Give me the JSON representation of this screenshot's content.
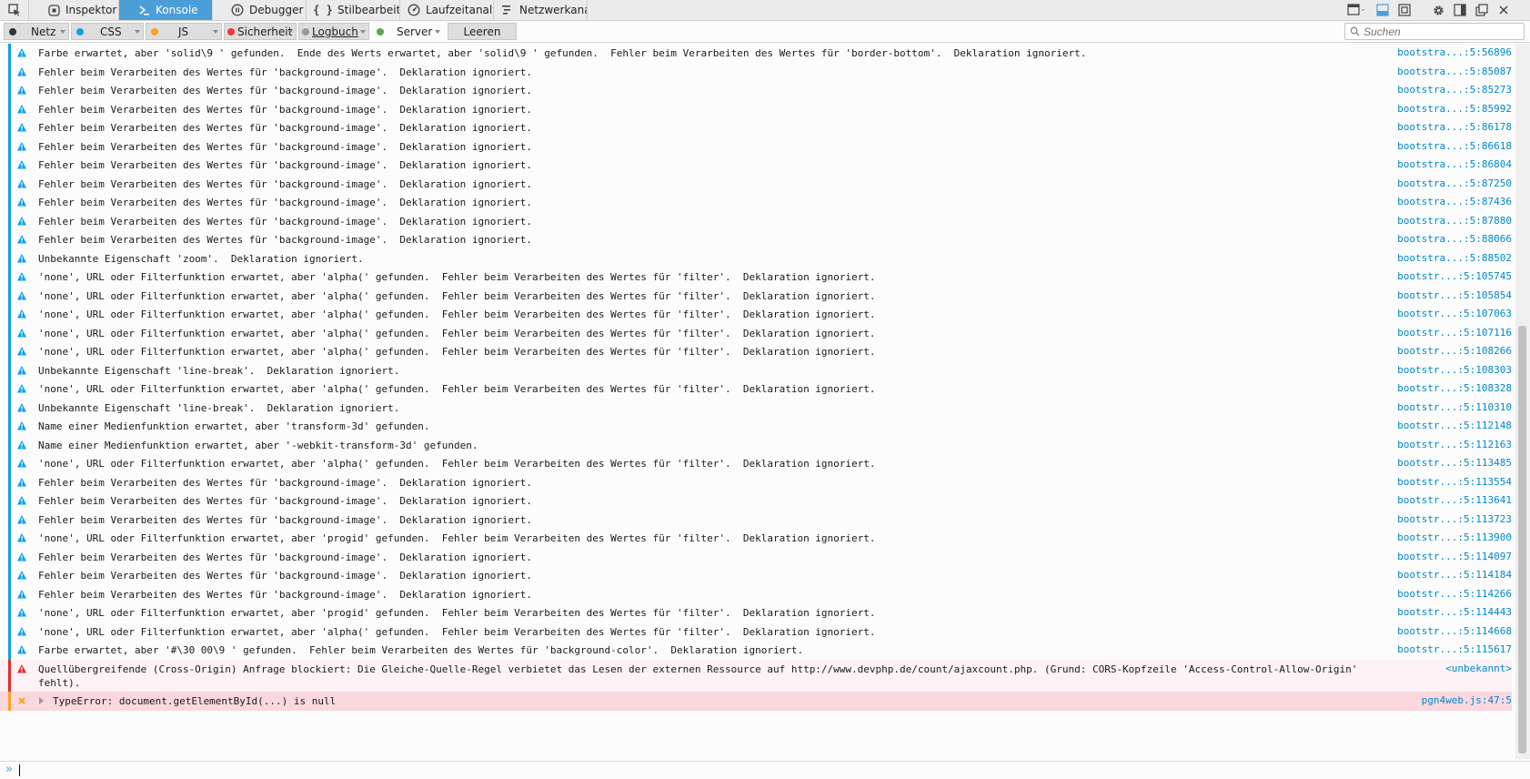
{
  "toolbar": {
    "tabs": [
      {
        "label": "Inspektor",
        "icon": "inspector-icon"
      },
      {
        "label": "Konsole",
        "icon": "console-icon",
        "active": true
      },
      {
        "label": "Debugger",
        "icon": "debugger-icon"
      },
      {
        "label": "Stilbearbeitu...",
        "icon": "style-editor-icon"
      },
      {
        "label": "Laufzeitanaly...",
        "icon": "performance-icon"
      },
      {
        "label": "Netzwerkana...",
        "icon": "network-icon"
      }
    ],
    "accent": "#4c9ed9"
  },
  "filters": {
    "netz": "Netz",
    "css": "CSS",
    "js": "JS",
    "sicherheit": "Sicherheit",
    "logbuch": "Logbuch",
    "server": "Server",
    "leeren": "Leeren",
    "search_placeholder": "Suchen",
    "colors": {
      "netz": "#333333",
      "css": "#0ca2e8",
      "js": "#f7a51b",
      "sicherheit": "#ee3a3a",
      "logbuch": "#999999",
      "server": "#5ba846"
    }
  },
  "console": {
    "messages": [
      {
        "sev": "warn",
        "text": "Farbe erwartet, aber 'solid\\9 ' gefunden.  Ende des Werts erwartet, aber 'solid\\9 ' gefunden.  Fehler beim Verarbeiten des Wertes für 'border-bottom'.  Deklaration ignoriert.",
        "loc": "bootstra...:5:56896"
      },
      {
        "sev": "warn",
        "text": "Fehler beim Verarbeiten des Wertes für 'background-image'.  Deklaration ignoriert.",
        "loc": "bootstra...:5:85087"
      },
      {
        "sev": "warn",
        "text": "Fehler beim Verarbeiten des Wertes für 'background-image'.  Deklaration ignoriert.",
        "loc": "bootstra...:5:85273"
      },
      {
        "sev": "warn",
        "text": "Fehler beim Verarbeiten des Wertes für 'background-image'.  Deklaration ignoriert.",
        "loc": "bootstra...:5:85992"
      },
      {
        "sev": "warn",
        "text": "Fehler beim Verarbeiten des Wertes für 'background-image'.  Deklaration ignoriert.",
        "loc": "bootstra...:5:86178"
      },
      {
        "sev": "warn",
        "text": "Fehler beim Verarbeiten des Wertes für 'background-image'.  Deklaration ignoriert.",
        "loc": "bootstra...:5:86618"
      },
      {
        "sev": "warn",
        "text": "Fehler beim Verarbeiten des Wertes für 'background-image'.  Deklaration ignoriert.",
        "loc": "bootstra...:5:86804"
      },
      {
        "sev": "warn",
        "text": "Fehler beim Verarbeiten des Wertes für 'background-image'.  Deklaration ignoriert.",
        "loc": "bootstra...:5:87250"
      },
      {
        "sev": "warn",
        "text": "Fehler beim Verarbeiten des Wertes für 'background-image'.  Deklaration ignoriert.",
        "loc": "bootstra...:5:87436"
      },
      {
        "sev": "warn",
        "text": "Fehler beim Verarbeiten des Wertes für 'background-image'.  Deklaration ignoriert.",
        "loc": "bootstra...:5:87880"
      },
      {
        "sev": "warn",
        "text": "Fehler beim Verarbeiten des Wertes für 'background-image'.  Deklaration ignoriert.",
        "loc": "bootstra...:5:88066"
      },
      {
        "sev": "warn",
        "text": "Unbekannte Eigenschaft 'zoom'.  Deklaration ignoriert.",
        "loc": "bootstra...:5:88502"
      },
      {
        "sev": "warn",
        "text": "'none', URL oder Filterfunktion erwartet, aber 'alpha(' gefunden.  Fehler beim Verarbeiten des Wertes für 'filter'.  Deklaration ignoriert.",
        "loc": "bootstr...:5:105745"
      },
      {
        "sev": "warn",
        "text": "'none', URL oder Filterfunktion erwartet, aber 'alpha(' gefunden.  Fehler beim Verarbeiten des Wertes für 'filter'.  Deklaration ignoriert.",
        "loc": "bootstr...:5:105854"
      },
      {
        "sev": "warn",
        "text": "'none', URL oder Filterfunktion erwartet, aber 'alpha(' gefunden.  Fehler beim Verarbeiten des Wertes für 'filter'.  Deklaration ignoriert.",
        "loc": "bootstr...:5:107063"
      },
      {
        "sev": "warn",
        "text": "'none', URL oder Filterfunktion erwartet, aber 'alpha(' gefunden.  Fehler beim Verarbeiten des Wertes für 'filter'.  Deklaration ignoriert.",
        "loc": "bootstr...:5:107116"
      },
      {
        "sev": "warn",
        "text": "'none', URL oder Filterfunktion erwartet, aber 'alpha(' gefunden.  Fehler beim Verarbeiten des Wertes für 'filter'.  Deklaration ignoriert.",
        "loc": "bootstr...:5:108266"
      },
      {
        "sev": "warn",
        "text": "Unbekannte Eigenschaft 'line-break'.  Deklaration ignoriert.",
        "loc": "bootstr...:5:108303"
      },
      {
        "sev": "warn",
        "text": "'none', URL oder Filterfunktion erwartet, aber 'alpha(' gefunden.  Fehler beim Verarbeiten des Wertes für 'filter'.  Deklaration ignoriert.",
        "loc": "bootstr...:5:108328"
      },
      {
        "sev": "warn",
        "text": "Unbekannte Eigenschaft 'line-break'.  Deklaration ignoriert.",
        "loc": "bootstr...:5:110310"
      },
      {
        "sev": "warn",
        "text": "Name einer Medienfunktion erwartet, aber 'transform-3d' gefunden.",
        "loc": "bootstr...:5:112148"
      },
      {
        "sev": "warn",
        "text": "Name einer Medienfunktion erwartet, aber '-webkit-transform-3d' gefunden.",
        "loc": "bootstr...:5:112163"
      },
      {
        "sev": "warn",
        "text": "'none', URL oder Filterfunktion erwartet, aber 'alpha(' gefunden.  Fehler beim Verarbeiten des Wertes für 'filter'.  Deklaration ignoriert.",
        "loc": "bootstr...:5:113485"
      },
      {
        "sev": "warn",
        "text": "Fehler beim Verarbeiten des Wertes für 'background-image'.  Deklaration ignoriert.",
        "loc": "bootstr...:5:113554"
      },
      {
        "sev": "warn",
        "text": "Fehler beim Verarbeiten des Wertes für 'background-image'.  Deklaration ignoriert.",
        "loc": "bootstr...:5:113641"
      },
      {
        "sev": "warn",
        "text": "Fehler beim Verarbeiten des Wertes für 'background-image'.  Deklaration ignoriert.",
        "loc": "bootstr...:5:113723"
      },
      {
        "sev": "warn",
        "text": "'none', URL oder Filterfunktion erwartet, aber 'progid' gefunden.  Fehler beim Verarbeiten des Wertes für 'filter'.  Deklaration ignoriert.",
        "loc": "bootstr...:5:113900"
      },
      {
        "sev": "warn",
        "text": "Fehler beim Verarbeiten des Wertes für 'background-image'.  Deklaration ignoriert.",
        "loc": "bootstr...:5:114097"
      },
      {
        "sev": "warn",
        "text": "Fehler beim Verarbeiten des Wertes für 'background-image'.  Deklaration ignoriert.",
        "loc": "bootstr...:5:114184"
      },
      {
        "sev": "warn",
        "text": "Fehler beim Verarbeiten des Wertes für 'background-image'.  Deklaration ignoriert.",
        "loc": "bootstr...:5:114266"
      },
      {
        "sev": "warn",
        "text": "'none', URL oder Filterfunktion erwartet, aber 'progid' gefunden.  Fehler beim Verarbeiten des Wertes für 'filter'.  Deklaration ignoriert.",
        "loc": "bootstr...:5:114443"
      },
      {
        "sev": "warn",
        "text": "'none', URL oder Filterfunktion erwartet, aber 'alpha(' gefunden.  Fehler beim Verarbeiten des Wertes für 'filter'.  Deklaration ignoriert.",
        "loc": "bootstr...:5:114668"
      },
      {
        "sev": "warn",
        "text": "Farbe erwartet, aber '#\\30 00\\9 ' gefunden.  Fehler beim Verarbeiten des Wertes für 'background-color'.  Deklaration ignoriert.",
        "loc": "bootstr...:5:115617"
      },
      {
        "sev": "error",
        "text": "Quellübergreifende (Cross-Origin) Anfrage blockiert: Die Gleiche-Quelle-Regel verbietet das Lesen der externen Ressource auf http://www.devphp.de/count/ajaxcount.php. (Grund: CORS-Kopfzeile 'Access-Control-Allow-Origin' fehlt).",
        "loc": "<unbekannt>"
      },
      {
        "sev": "jserror",
        "text": "TypeError: document.getElementById(...) is null",
        "loc": "pgn4web.js:47:5"
      }
    ]
  },
  "input": {
    "prompt": "»",
    "value": ""
  },
  "colors": {
    "css_stripe": "#0ca2e8",
    "warn_icon": "#0ca2e8",
    "error_stripe": "#e52c2c",
    "js_stripe": "#f7a51b",
    "link": "#0088cc"
  }
}
